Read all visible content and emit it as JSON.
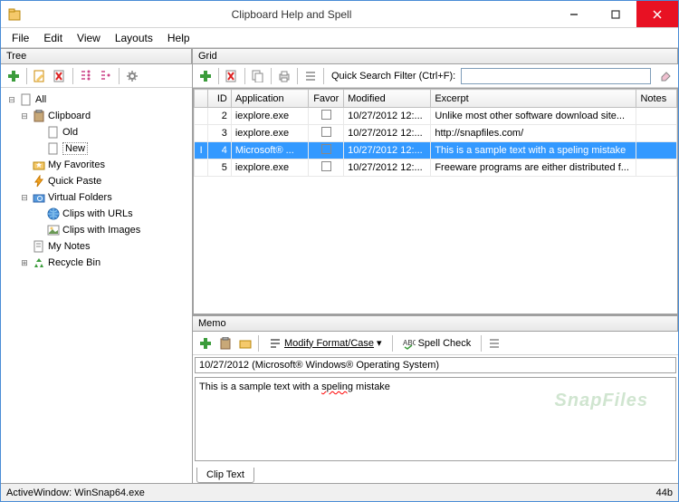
{
  "window": {
    "title": "Clipboard Help and Spell"
  },
  "menubar": [
    "File",
    "Edit",
    "View",
    "Layouts",
    "Help"
  ],
  "tree": {
    "header": "Tree",
    "nodes": {
      "all": "All",
      "clipboard": "Clipboard",
      "old": "Old",
      "new": "New",
      "favorites": "My Favorites",
      "quickpaste": "Quick Paste",
      "virtualfolders": "Virtual Folders",
      "clipsurls": "Clips with URLs",
      "clipsimages": "Clips with Images",
      "mynotes": "My Notes",
      "recyclebin": "Recycle Bin"
    }
  },
  "grid": {
    "header": "Grid",
    "search_label": "Quick Search Filter (Ctrl+F):",
    "columns": {
      "id": "ID",
      "application": "Application",
      "favor": "Favor",
      "modified": "Modified",
      "excerpt": "Excerpt",
      "notes": "Notes"
    },
    "rows": [
      {
        "id": "2",
        "application": "iexplore.exe",
        "favor": false,
        "modified": "10/27/2012 12:...",
        "excerpt": "Unlike most other software download site...",
        "notes": ""
      },
      {
        "id": "3",
        "application": "iexplore.exe",
        "favor": false,
        "modified": "10/27/2012 12:...",
        "excerpt": "http://snapfiles.com/",
        "notes": ""
      },
      {
        "id": "4",
        "application": "Microsoft® ...",
        "favor": true,
        "modified": "10/27/2012 12:...",
        "excerpt": "This is a sample text with a speling mistake",
        "notes": "",
        "selected": true
      },
      {
        "id": "5",
        "application": "iexplore.exe",
        "favor": false,
        "modified": "10/27/2012 12:...",
        "excerpt": "Freeware programs are either distributed f...",
        "notes": ""
      }
    ]
  },
  "memo": {
    "header": "Memo",
    "modify_label": "Modify Format/Case",
    "spellcheck_label": "Spell Check",
    "date_line": "10/27/2012 (Microsoft® Windows® Operating System)",
    "body_pre": "This is a sample text with a ",
    "body_err": "speling",
    "body_post": " mistake",
    "tab_label": "Clip Text",
    "watermark": "SnapFiles"
  },
  "statusbar": {
    "left": "ActiveWindow: WinSnap64.exe",
    "right": "44b"
  }
}
